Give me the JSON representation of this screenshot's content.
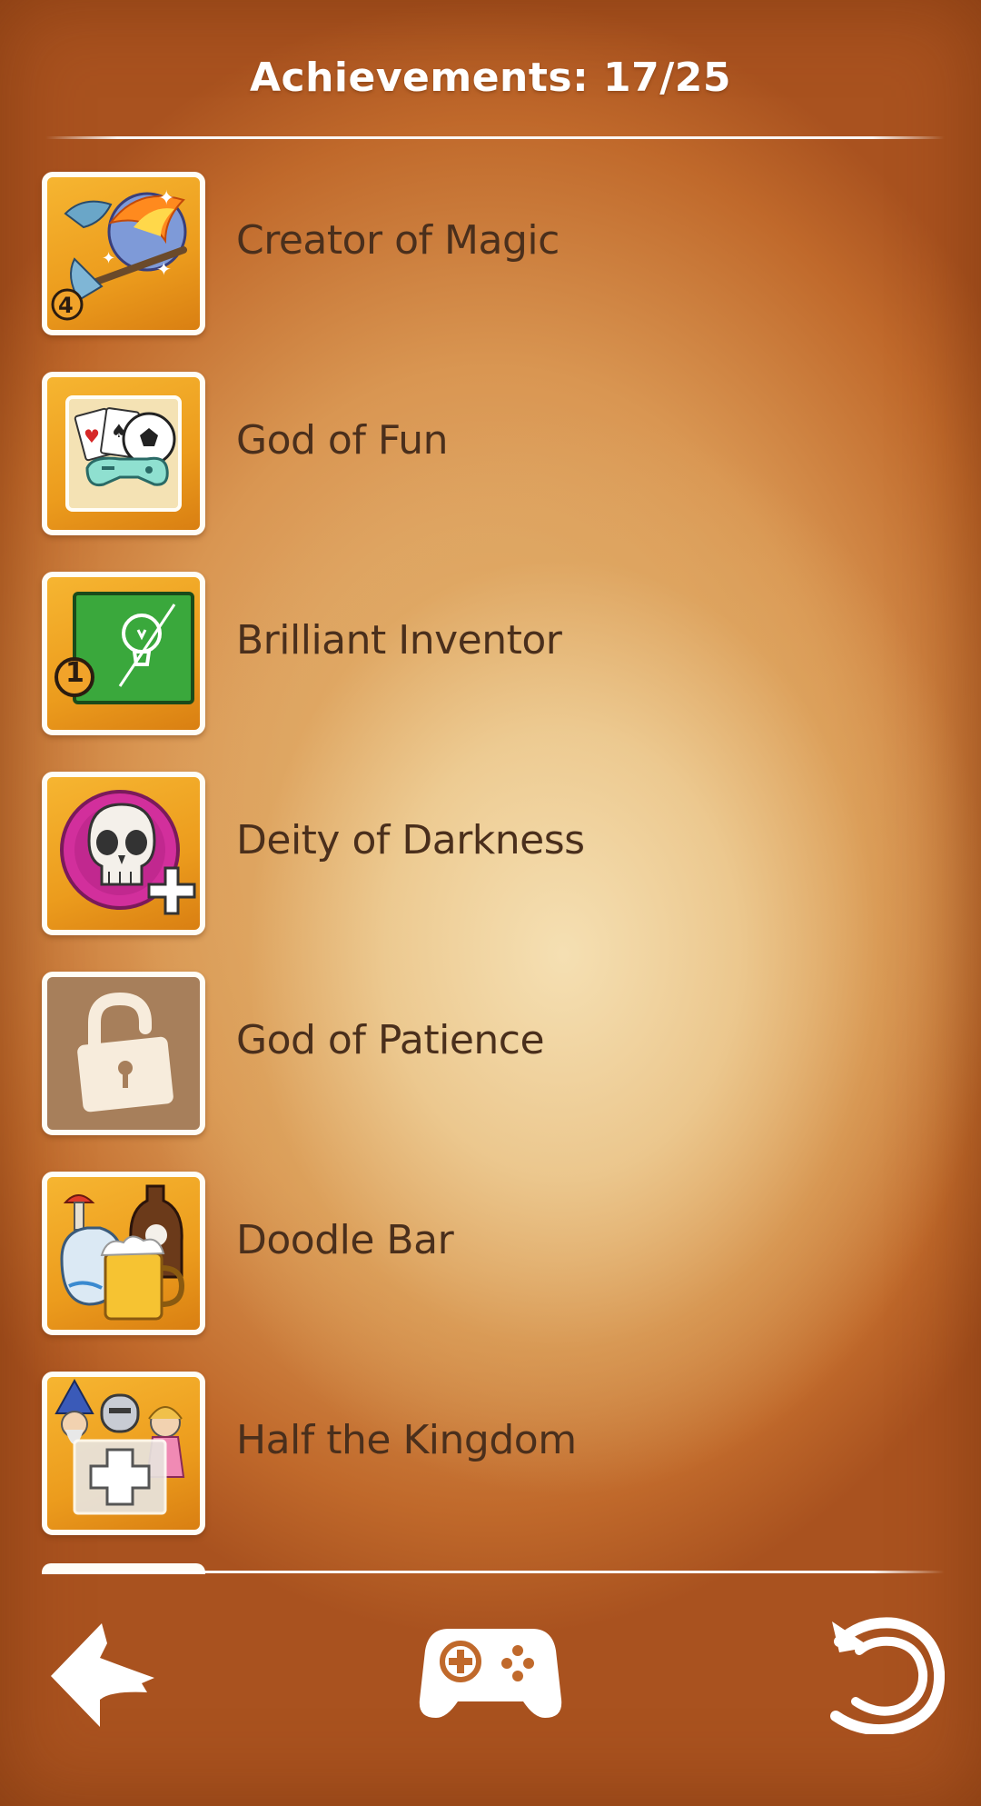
{
  "header": {
    "title": "Achievements: 17/25"
  },
  "achievements": [
    {
      "label": "Creator of Magic",
      "icon": "magic-fireball-icon",
      "number": "4"
    },
    {
      "label": "God of Fun",
      "icon": "games-toys-icon"
    },
    {
      "label": "Brilliant Inventor",
      "icon": "lightbulb-blackboard-icon",
      "number": "1"
    },
    {
      "label": "Deity of Darkness",
      "icon": "skull-icon"
    },
    {
      "label": "God of Patience",
      "icon": "unlocked-padlock-icon"
    },
    {
      "label": "Doodle Bar",
      "icon": "drinks-bar-icon"
    },
    {
      "label": "Half the Kingdom",
      "icon": "wizard-knight-princess-icon"
    }
  ],
  "nav": {
    "back_icon": "back-arrow-icon",
    "games_icon": "gamepad-icon",
    "reset_icon": "undo-refresh-icon"
  },
  "colors": {
    "background": "#c0692b",
    "badge_orange": "#ec9c1d",
    "locked_badge": "#a77f5b",
    "label_text": "#4a2f1c"
  }
}
